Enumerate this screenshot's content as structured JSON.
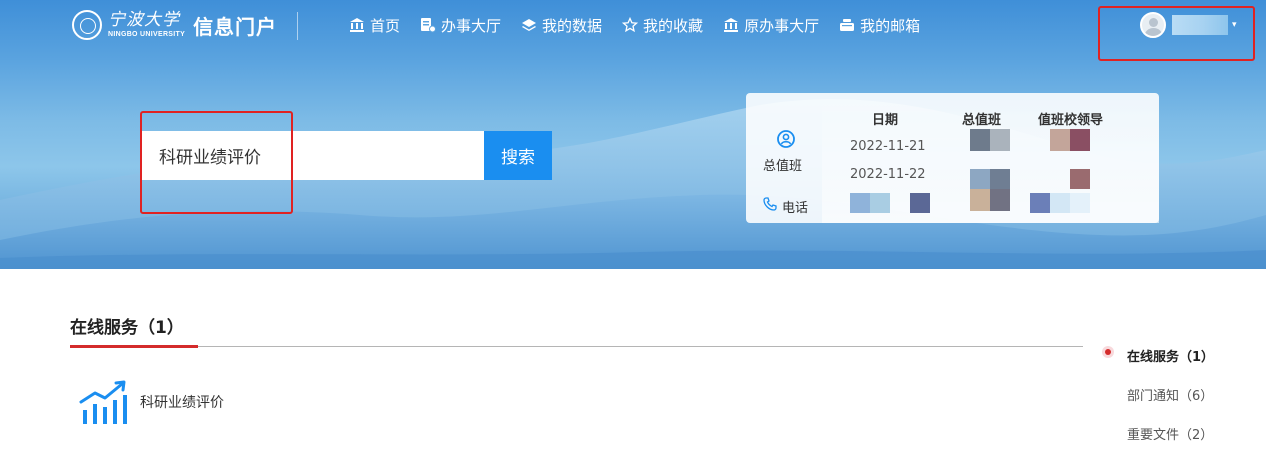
{
  "logo": {
    "university_cn": "宁波大学",
    "university_en": "NINGBO UNIVERSITY",
    "portal_name": "信息门户"
  },
  "nav": {
    "items": [
      {
        "label": "首页",
        "icon": "bank-icon"
      },
      {
        "label": "办事大厅",
        "icon": "service-hall-icon"
      },
      {
        "label": "我的数据",
        "icon": "layers-icon"
      },
      {
        "label": "我的收藏",
        "icon": "star-icon"
      },
      {
        "label": "原办事大厅",
        "icon": "bank-icon"
      },
      {
        "label": "我的邮箱",
        "icon": "mailbox-icon"
      }
    ]
  },
  "user": {
    "name": ""
  },
  "search": {
    "value": "科研业绩评价",
    "button_label": "搜索"
  },
  "duty": {
    "label": "总值班",
    "phone_label": "电话",
    "columns": [
      "日期",
      "总值班",
      "值班校领导"
    ],
    "rows": [
      {
        "date": "2022-11-21"
      },
      {
        "date": "2022-11-22"
      }
    ]
  },
  "content": {
    "section_title": "在线服务（1）",
    "services": [
      {
        "label": "科研业绩评价"
      }
    ]
  },
  "side_nav": {
    "items": [
      {
        "label": "在线服务（1）",
        "active": true
      },
      {
        "label": "部门通知（6）",
        "active": false
      },
      {
        "label": "重要文件（2）",
        "active": false
      }
    ]
  },
  "colors": {
    "accent_blue": "#1a8ef0",
    "highlight_red": "#e02222",
    "active_red": "#d42b2b"
  }
}
